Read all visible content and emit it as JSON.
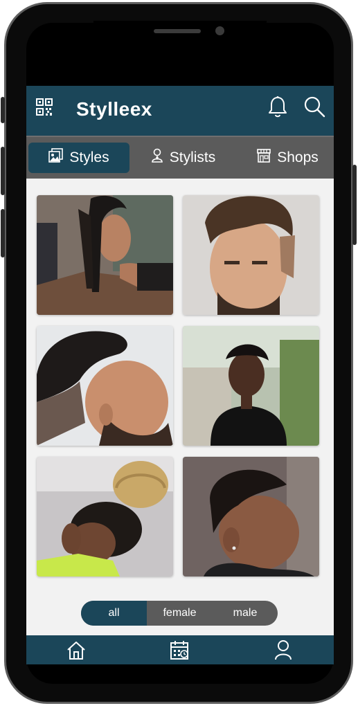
{
  "app": {
    "title": "Stylleex"
  },
  "header_icons": [
    "qr-code-icon",
    "bell-icon",
    "search-icon"
  ],
  "tabs": [
    {
      "label": "Styles",
      "icon": "photo-stack-icon",
      "active": true
    },
    {
      "label": "Stylists",
      "icon": "person-pin-icon",
      "active": false
    },
    {
      "label": "Shops",
      "icon": "storefront-icon",
      "active": false
    }
  ],
  "gallery": [
    {
      "name": "cornrow-braids-woman"
    },
    {
      "name": "textured-quiff-man"
    },
    {
      "name": "spiky-fade-beard-man"
    },
    {
      "name": "short-natural-tapered-woman"
    },
    {
      "name": "braided-bun-woman"
    },
    {
      "name": "curly-top-fade-man"
    }
  ],
  "filter": {
    "options": [
      "all",
      "female",
      "male"
    ],
    "selected": "all"
  },
  "bottom_nav": [
    "home-icon",
    "calendar-icon",
    "profile-icon"
  ],
  "colors": {
    "primary": "#1b4659",
    "tab_bar": "#5b5b5b",
    "background": "#f2f2f2"
  }
}
